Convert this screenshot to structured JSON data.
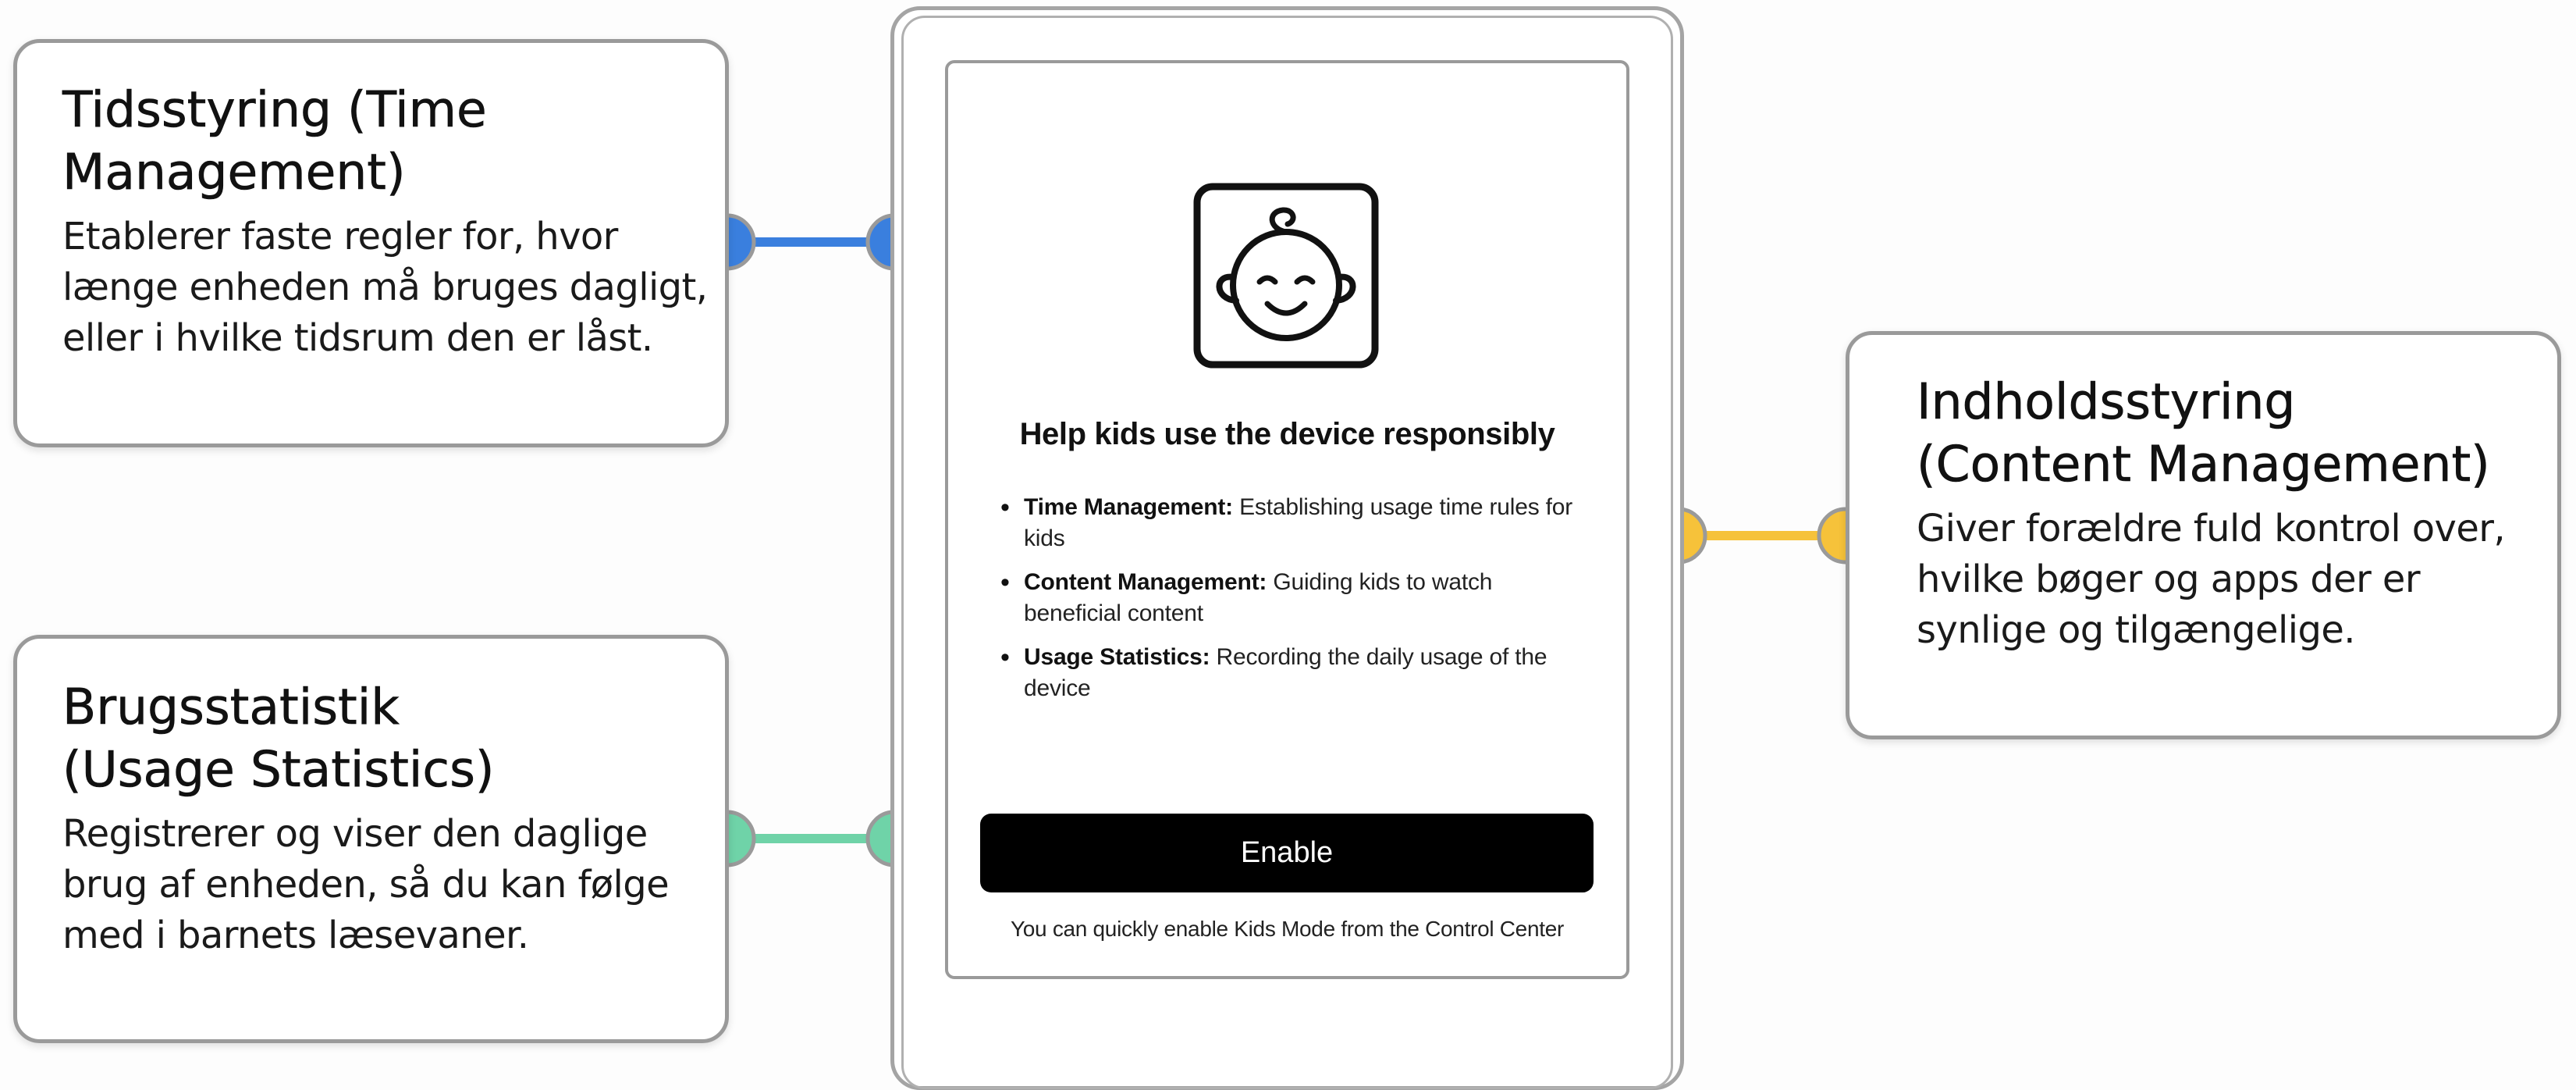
{
  "callouts": {
    "time": {
      "title": [
        "Tidsstyring (Time",
        "Management)"
      ],
      "body": [
        "Etablerer faste regler for, hvor",
        "længe enheden må bruges dagligt,",
        "eller i hvilke tidsrum den er låst."
      ],
      "color": "#3a7fde"
    },
    "usage": {
      "title": [
        "Brugsstatistik",
        "(Usage Statistics)"
      ],
      "body": [
        "Registrerer og viser den daglige",
        "brug af enheden, så du kan følge",
        "med i barnets læsevaner."
      ],
      "color": "#6fd3a8"
    },
    "content": {
      "title": [
        "Indholdsstyring",
        "(Content Management)"
      ],
      "body": [
        "Giver forældre fuld kontrol over,",
        "hvilke bøger og apps der er",
        "synlige og tilgængelige."
      ],
      "color": "#f6c23a"
    }
  },
  "device": {
    "icon": "baby-face-icon",
    "heading": "Help kids use the device responsibly",
    "features": [
      {
        "label": "Time Management:",
        "text": " Establishing usage time rules for kids"
      },
      {
        "label": "Content Management:",
        "text": " Guiding kids to watch beneficial content"
      },
      {
        "label": "Usage Statistics:",
        "text": " Recording the daily usage of the device"
      }
    ],
    "button_label": "Enable",
    "hint": "You can quickly enable Kids Mode from the Control Center"
  }
}
